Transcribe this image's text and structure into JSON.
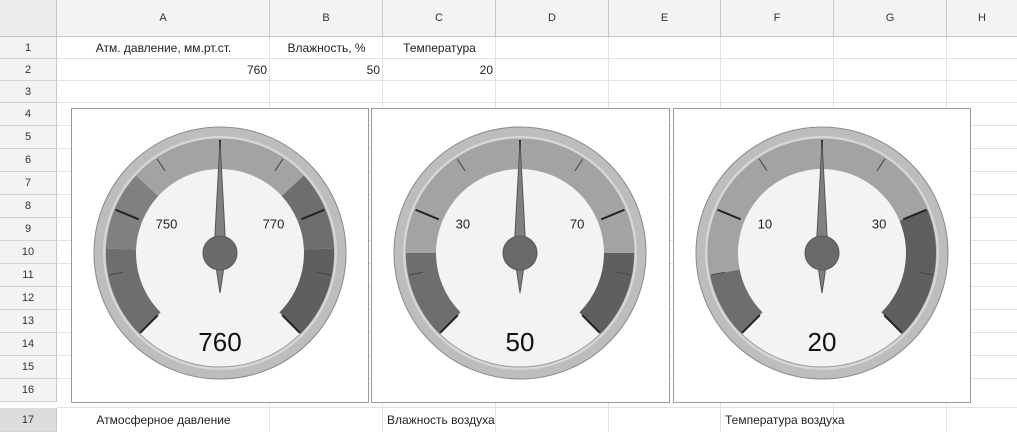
{
  "columns": [
    "A",
    "B",
    "C",
    "D",
    "E",
    "F",
    "G",
    "H"
  ],
  "rows": [
    "1",
    "2",
    "3",
    "4",
    "5",
    "6",
    "7",
    "8",
    "9",
    "10",
    "11",
    "12",
    "13",
    "14",
    "15",
    "16",
    "17"
  ],
  "cells": {
    "A1": "Атм. давление, мм.рт.ст.",
    "B1": "Влажность, %",
    "C1": "Температура",
    "A2": "760",
    "B2": "50",
    "C2": "20",
    "A17": "Атмосферное давление",
    "C17": "Влажность воздуха",
    "F17": "Температура воздуха"
  },
  "gauges": [
    {
      "value": 760,
      "value_text": "760",
      "min": 740,
      "max": 780,
      "label_low": "750",
      "label_high": "770",
      "bands": [
        [
          740,
          747,
          "#6e6e6e"
        ],
        [
          747,
          753,
          "#808080"
        ],
        [
          753,
          767,
          "#a3a3a3"
        ],
        [
          767,
          773,
          "#6e6e6e"
        ],
        [
          773,
          780,
          "#5f5f5f"
        ]
      ]
    },
    {
      "value": 50,
      "value_text": "50",
      "min": 20,
      "max": 80,
      "label_low": "30",
      "label_high": "70",
      "bands": [
        [
          20,
          30,
          "#6e6e6e"
        ],
        [
          30,
          70,
          "#a3a3a3"
        ],
        [
          70,
          80,
          "#5f5f5f"
        ]
      ]
    },
    {
      "value": 20,
      "value_text": "20",
      "min": 0,
      "max": 40,
      "label_low": "10",
      "label_high": "30",
      "bands": [
        [
          0,
          5,
          "#6e6e6e"
        ],
        [
          5,
          30,
          "#a3a3a3"
        ],
        [
          30,
          40,
          "#5f5f5f"
        ]
      ]
    }
  ]
}
